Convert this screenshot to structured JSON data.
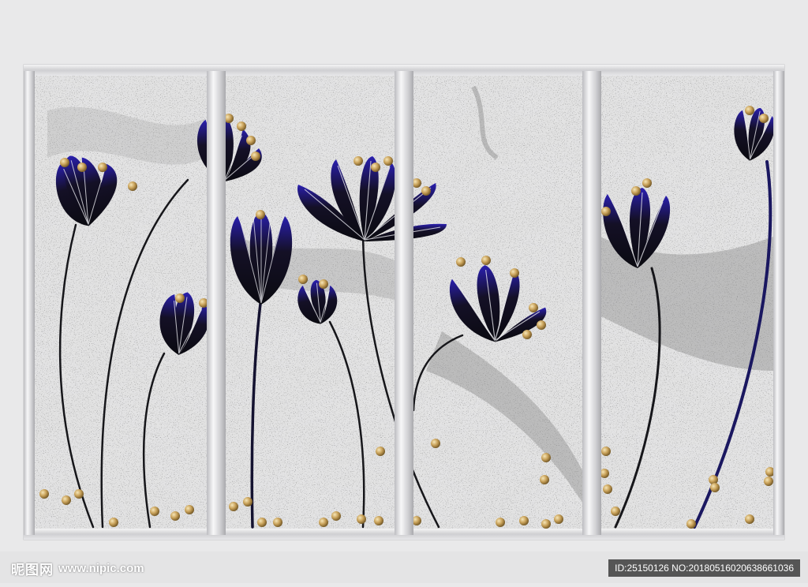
{
  "image": {
    "subject": "",
    "colors": {
      "background": "#e9e9ea",
      "frame": "#d6d6d8",
      "marble": "#c9c9c9",
      "petal_dark": "#101018",
      "petal_accent": "#2a1fb0",
      "bead_gold": "#c9a25a"
    }
  },
  "watermark": {
    "logo_text": "昵图网",
    "url_text": "www.nipic.com",
    "id_text": "ID:25150126 NO:20180516020638661036"
  }
}
